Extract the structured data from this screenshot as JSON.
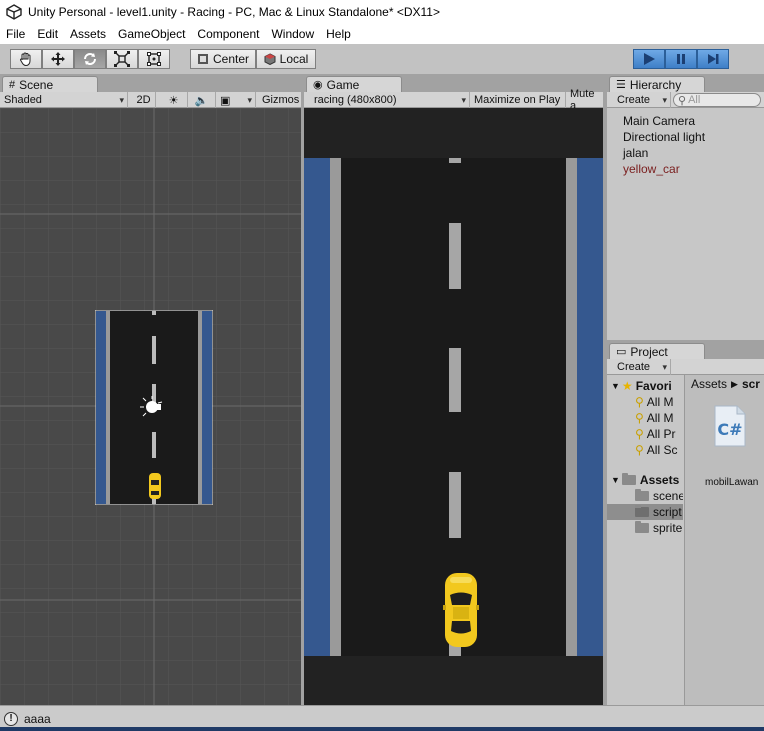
{
  "window": {
    "title": "Unity Personal - level1.unity - Racing - PC, Mac & Linux Standalone* <DX11>"
  },
  "menu": [
    "File",
    "Edit",
    "Assets",
    "GameObject",
    "Component",
    "Window",
    "Help"
  ],
  "toolbar": {
    "tools": [
      "hand-tool",
      "move-tool",
      "rotate-tool",
      "scale-tool",
      "rect-tool"
    ],
    "active_tool": "rotate-tool",
    "pivot_label": "Center",
    "space_label": "Local",
    "play_active": true
  },
  "scene": {
    "tab_label": "Scene",
    "shading": "Shaded",
    "mode_2d": "2D",
    "gizmos_label": "Gizmos"
  },
  "game": {
    "tab_label": "Game",
    "resolution": "racing (480x800)",
    "maximize_label": "Maximize on Play",
    "mute_label": "Mute a"
  },
  "hierarchy": {
    "tab_label": "Hierarchy",
    "create_label": "Create",
    "search_placeholder": "All",
    "items": [
      "Main Camera",
      "Directional light",
      "jalan",
      "yellow_car"
    ],
    "selected_index": 3
  },
  "project": {
    "tab_label": "Project",
    "create_label": "Create",
    "favorites_label": "Favori",
    "favorite_items": [
      "All M",
      "All M",
      "All Pr",
      "All Sc"
    ],
    "assets_label": "Assets",
    "asset_folders": [
      "scene",
      "script",
      "sprite"
    ],
    "selected_folder": "script",
    "breadcrumb_root": "Assets",
    "breadcrumb_current": "scr",
    "file_name": "mobilLawan"
  },
  "status": {
    "message": "aaaa"
  },
  "colors": {
    "accent_blue": "#3e7fc7",
    "road": "#1a1a1a",
    "roadside_blue": "#35588f",
    "car_yellow": "#f2c81e",
    "selected_text": "#7a1e1e"
  }
}
